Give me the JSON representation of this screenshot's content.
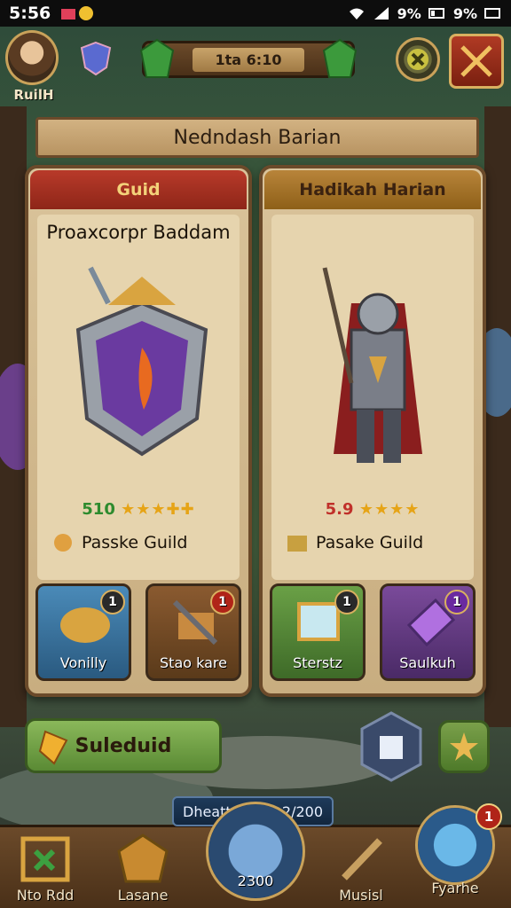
{
  "status_bar": {
    "time": "5:56",
    "battery": "9%",
    "battery2": "9%"
  },
  "topbar": {
    "player_name": "RuilH",
    "currency_value": "1ta 6:10"
  },
  "banner": {
    "title": "Nedndash Barian"
  },
  "cards": [
    {
      "header": "Guid",
      "title": "Proaxcorpr Baddam",
      "rating_num": "510",
      "stars": "★★★✚✚",
      "guild_label": "Passke Guild",
      "items": [
        {
          "label": "Vonilly",
          "badge": "1",
          "color": "blue"
        },
        {
          "label": "Stao kare",
          "badge": "1",
          "color": "brown"
        }
      ]
    },
    {
      "header": "Hadikah Harian",
      "title": "",
      "rating_num": "5.9",
      "stars": "★★★★",
      "guild_label": "Pasake Guild",
      "items": [
        {
          "label": "Sterstz",
          "badge": "1",
          "color": "green"
        },
        {
          "label": "Saulkuh",
          "badge": "1",
          "color": "purple"
        }
      ]
    }
  ],
  "actions": {
    "schedule_label": "Suleduid"
  },
  "progress": {
    "label": "Dheatt",
    "value": "2/200"
  },
  "nav": {
    "items": [
      {
        "label": "Nto Rdd"
      },
      {
        "label": "Lasane"
      },
      {
        "label": "2300"
      },
      {
        "label": "Musisl"
      },
      {
        "label": "Fyarhe"
      }
    ],
    "fire_badge": "1"
  },
  "colors": {
    "wood": "#6b4a2a",
    "parchment": "#e6d4ae",
    "red_header": "#b83a2a",
    "gold_header": "#b8843a",
    "green_button": "#8ab85a"
  }
}
